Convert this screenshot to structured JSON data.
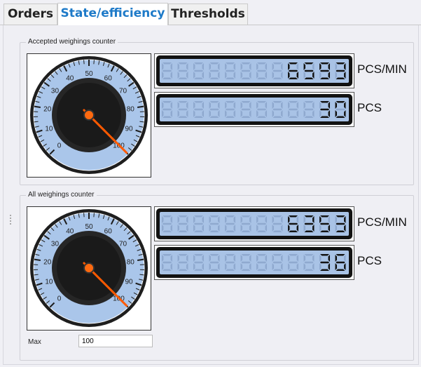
{
  "tabs": [
    {
      "label": "Orders",
      "active": false
    },
    {
      "label": "State/efficiency",
      "active": true
    },
    {
      "label": "Thresholds",
      "active": false
    }
  ],
  "accepted": {
    "title": "Accepted weighings counter",
    "gauge": {
      "min": 0,
      "max": 100,
      "ticks": [
        "0",
        "10",
        "20",
        "30",
        "40",
        "50",
        "60",
        "70",
        "80",
        "90",
        "100"
      ],
      "value": 6593
    },
    "rate": {
      "value": "6593",
      "unit": "PCS/MIN"
    },
    "count": {
      "value": "30",
      "unit": "PCS"
    }
  },
  "all": {
    "title": "All weighings counter",
    "gauge": {
      "min": 0,
      "max": 100,
      "ticks": [
        "0",
        "10",
        "20",
        "30",
        "40",
        "50",
        "60",
        "70",
        "80",
        "90",
        "100"
      ],
      "value": 6353
    },
    "rate": {
      "value": "6353",
      "unit": "PCS/MIN"
    },
    "count": {
      "value": "36",
      "unit": "PCS"
    },
    "max_label": "Max",
    "max_value": "100"
  },
  "colors": {
    "accent": "#1e7ac8",
    "lcd_bg": "#a9c3e6",
    "needle": "#ff5a00"
  }
}
